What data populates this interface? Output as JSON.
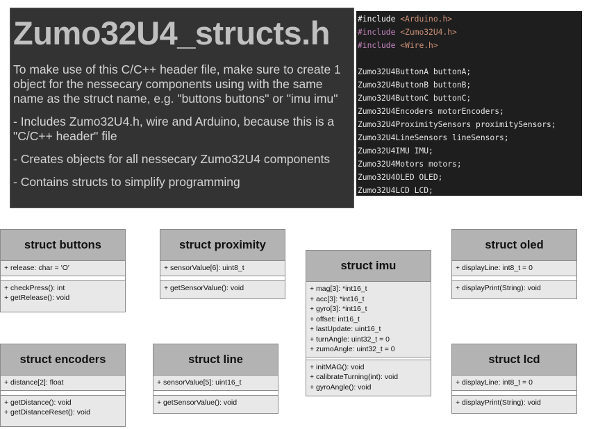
{
  "intro": {
    "title": "Zumo32U4_structs.h",
    "paragraphs": [
      "To make use of this C/C++ header file, make sure to create 1 object for the nessecary components using with the same name as the struct name, e.g. \"buttons buttons\" or \"imu imu\"",
      "- Includes Zumo32U4.h, wire and Arduino, because this is a \"C/C++ header\" file",
      "- Creates objects for all nessecary Zumo32U4 components",
      "- Contains structs to simplify programming"
    ]
  },
  "code": {
    "includes": [
      {
        "kw": "#include",
        "file": "<Arduino.h>"
      },
      {
        "kw": "#include",
        "file": "<Zumo32U4.h>"
      },
      {
        "kw": "#include",
        "file": "<Wire.h>"
      }
    ],
    "declarations": [
      "Zumo32U4ButtonA buttonA;",
      "Zumo32U4ButtonB buttonB;",
      "Zumo32U4ButtonC buttonC;",
      "Zumo32U4Encoders motorEncoders;",
      "Zumo32U4ProximitySensors proximitySensors;",
      "Zumo32U4LineSensors lineSensors;",
      "Zumo32U4IMU IMU;",
      "Zumo32U4Motors motors;",
      "Zumo32U4OLED OLED;",
      "Zumo32U4LCD LCD;"
    ]
  },
  "structs": {
    "buttons": {
      "title": "struct buttons",
      "attributes": [
        "+ release: char = 'O'"
      ],
      "operations": [
        "+ checkPress(): int",
        "+ getRelease(): void"
      ]
    },
    "proximity": {
      "title": "struct proximity",
      "attributes": [
        "+ sensorValue[6]: uint8_t"
      ],
      "operations": [
        "+ getSensorValue(): void"
      ]
    },
    "imu": {
      "title": "struct imu",
      "attributes": [
        "+ mag[3]: *int16_t",
        "+ acc[3]: *int16_t",
        "+ gyro[3]: *int16_t",
        "+ offset: int16_t",
        "+ lastUpdate: uint16_t",
        "+ turnAngle: uint32_t = 0",
        "+ zumoAngle: uint32_t = 0"
      ],
      "operations": [
        "+ initMAG(): void",
        "+ calibrateTurning(int): void",
        "+ gyroAngle(): void"
      ]
    },
    "oled": {
      "title": "struct oled",
      "attributes": [
        "+ displayLine: int8_t = 0"
      ],
      "operations": [
        "+ displayPrint(String): void"
      ]
    },
    "encoders": {
      "title": "struct encoders",
      "attributes": [
        "+ distance[2]: float"
      ],
      "operations": [
        "+ getDistance(): void",
        "+ getDistanceReset(): void"
      ]
    },
    "line": {
      "title": "struct line",
      "attributes": [
        "+ sensorValue[5]: uint16_t"
      ],
      "operations": [
        "+ getSensorValue(): void"
      ]
    },
    "lcd": {
      "title": "struct lcd",
      "attributes": [
        "+ displayLine: int8_t = 0"
      ],
      "operations": [
        "+ displayPrint(String): void"
      ]
    }
  }
}
